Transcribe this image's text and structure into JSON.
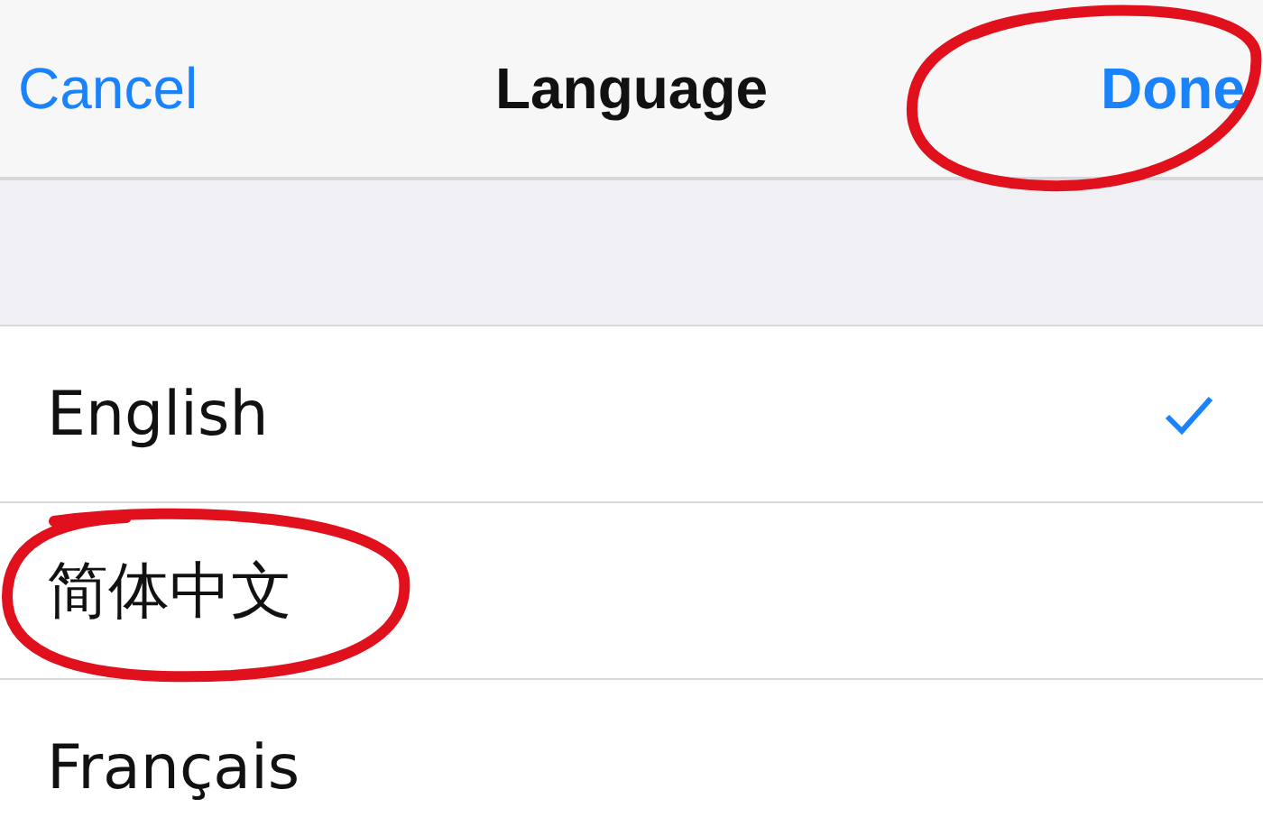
{
  "nav_bar": {
    "cancel": "Cancel",
    "title": "Language",
    "done": {
      "label": "Done",
      "circled": true
    }
  },
  "languages": [
    {
      "label": "English",
      "selected": true,
      "circled": false
    },
    {
      "label": "简体中文",
      "selected": false,
      "circled": true
    },
    {
      "label": "Français",
      "selected": false,
      "circled": false
    }
  ]
}
